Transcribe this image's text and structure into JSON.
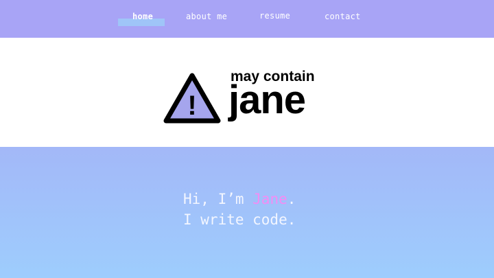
{
  "nav": {
    "items": [
      {
        "label": "home",
        "active": true
      },
      {
        "label": "about me",
        "active": false
      },
      {
        "label": "resume",
        "active": false
      },
      {
        "label": "contact",
        "active": false
      }
    ]
  },
  "logo": {
    "line1": "may contain",
    "line2": "jane",
    "icon": "warning-triangle-icon",
    "icon_glyph": "!"
  },
  "hero": {
    "greeting_prefix": "Hi, I’m ",
    "name": "Jane",
    "greeting_suffix": ".",
    "tagline": "I write code."
  },
  "colors": {
    "nav_bg": "#a8a4f6",
    "nav_active_underline": "#9fc5f8",
    "hero_gradient_top": "#a3b8f8",
    "hero_gradient_bottom": "#9ecdfd",
    "icon_fill": "#a5a5ed",
    "name_highlight": "#f48cf4",
    "hero_text": "#f3f6ff"
  }
}
